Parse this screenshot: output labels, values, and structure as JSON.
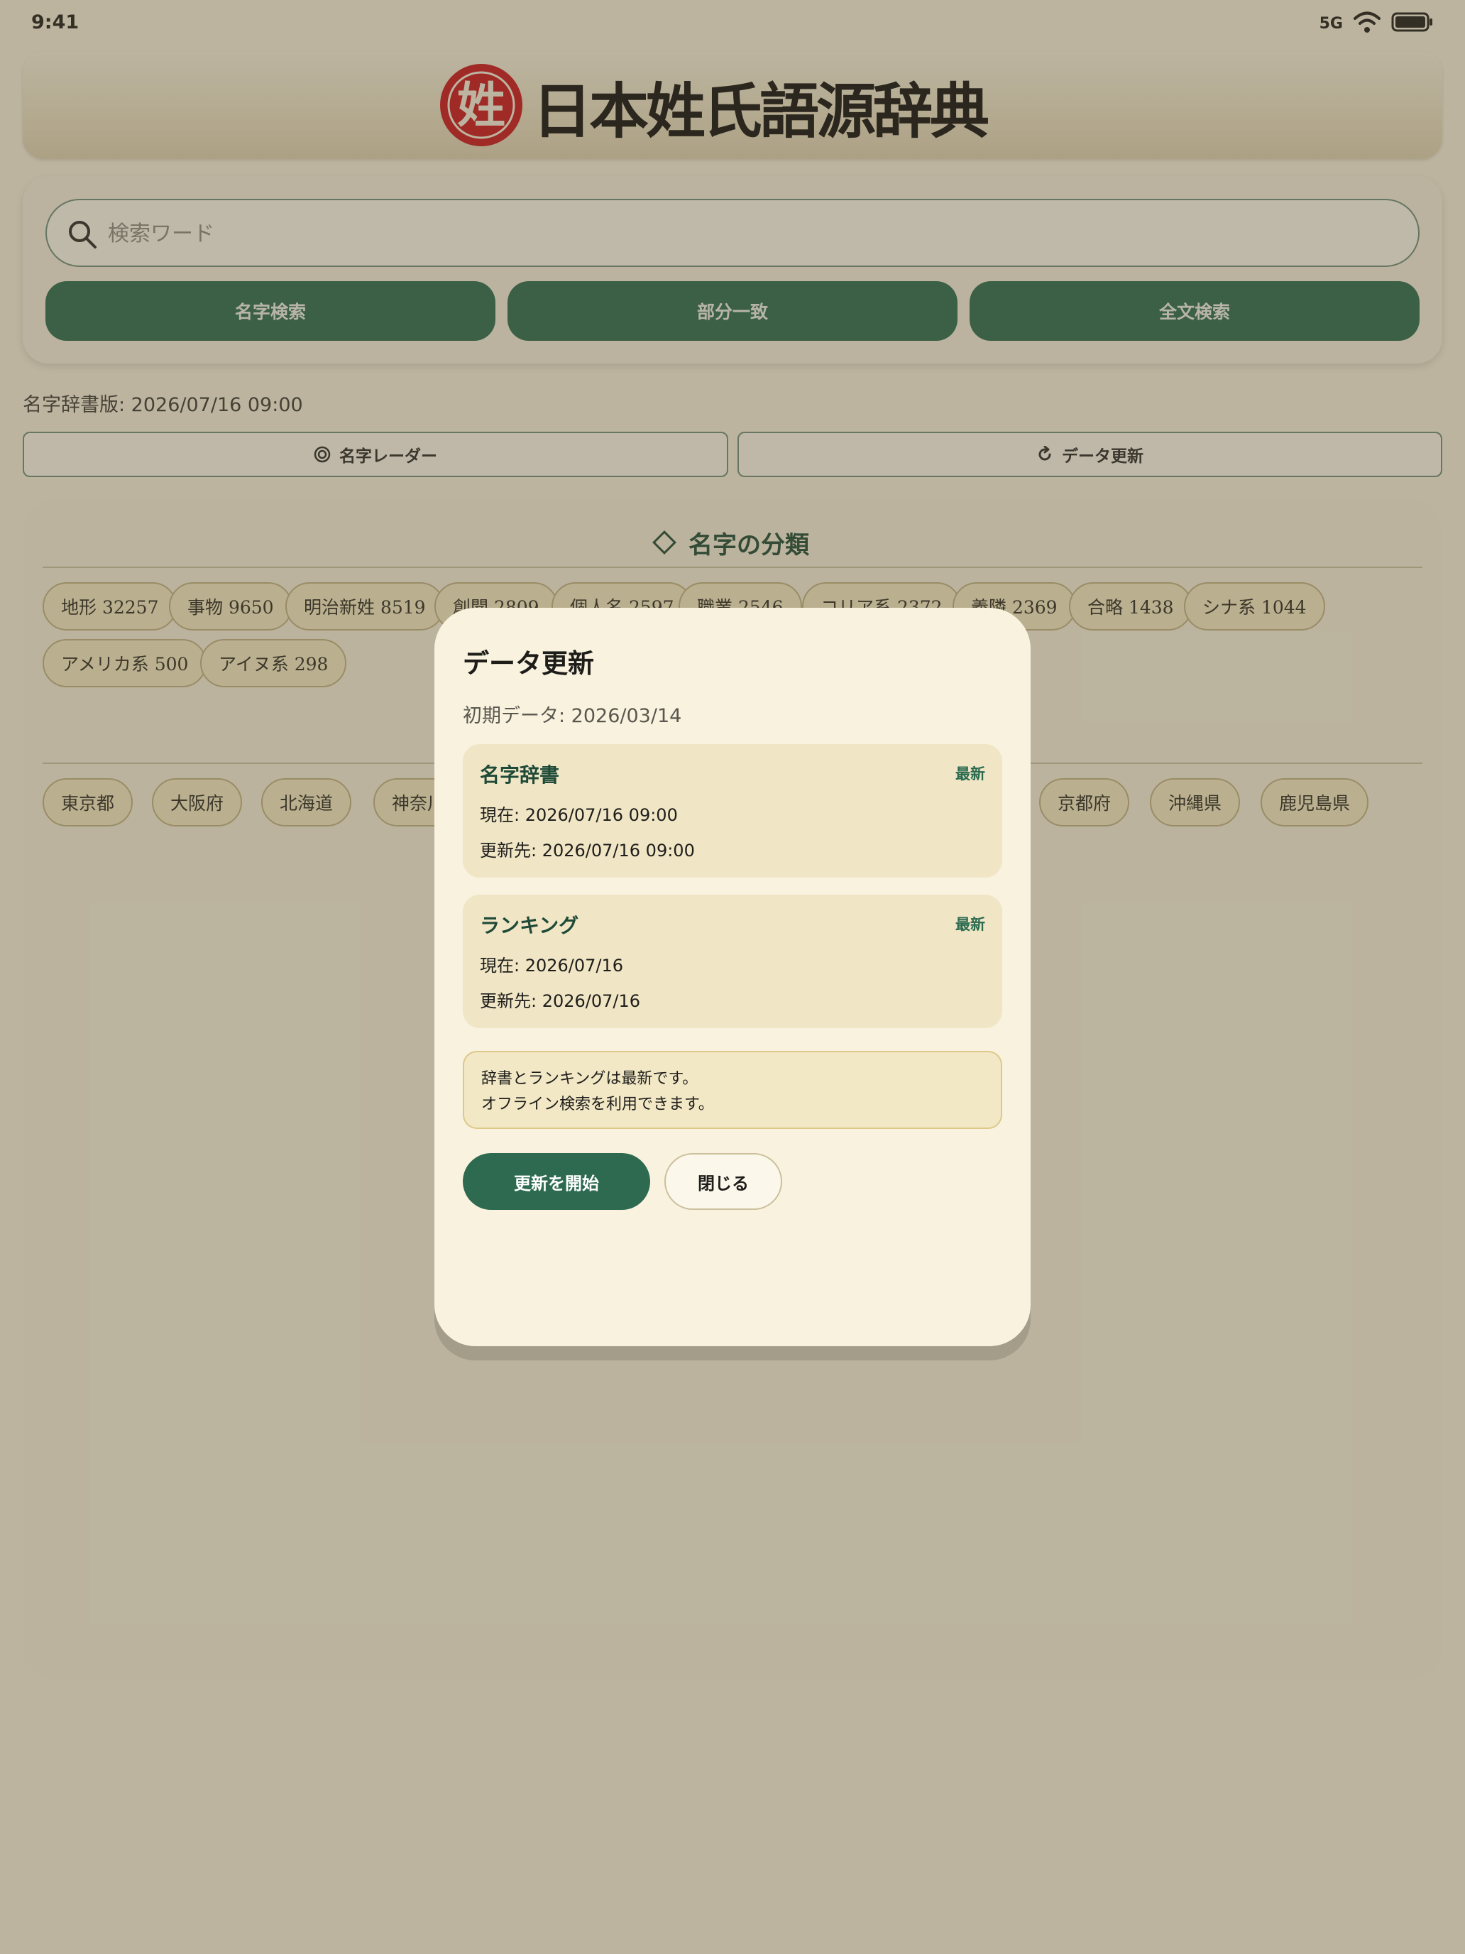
{
  "status_bar": {
    "time": "9:41",
    "network": "5G"
  },
  "header": {
    "logo_seal_char": "姓",
    "logo_text": "日本姓氏語源辞典"
  },
  "search": {
    "placeholder": "検索ワード",
    "buttons": [
      "名字検索",
      "部分一致",
      "全文検索"
    ]
  },
  "version_text": "名字辞書版: 2026/07/16 09:00",
  "tools": {
    "radar_label": "名字レーダー",
    "update_label": "データ更新"
  },
  "classification": {
    "title": "名字の分類",
    "categories": [
      "地形 32257",
      "事物 9650",
      "明治新姓 8519",
      "創聞 2809",
      "個人名 2597",
      "職業 2546",
      "コリア系 2372",
      "義隣 2369",
      "合略 1438",
      "シナ系 1044",
      "アメリカ系 500",
      "アイヌ系 298"
    ],
    "prefectures": [
      "東京都",
      "大阪府",
      "北海道",
      "神奈川県",
      "京都府",
      "沖縄県",
      "鹿児島県"
    ]
  },
  "modal": {
    "title": "データ更新",
    "initial_data": "初期データ: 2026/03/14",
    "cards": [
      {
        "title": "名字辞書",
        "badge": "最新",
        "current": "現在: 2026/07/16 09:00",
        "target": "更新先: 2026/07/16 09:00"
      },
      {
        "title": "ランキング",
        "badge": "最新",
        "current": "現在: 2026/07/16",
        "target": "更新先: 2026/07/16"
      }
    ],
    "notice_line1": "辞書とランキングは最新です。",
    "notice_line2": "オフライン検索を利用できます。",
    "start_button": "更新を開始",
    "close_button": "閉じる"
  },
  "colors": {
    "accent": "#2a6a4f",
    "modal_bg": "#f8f2de",
    "chip_bg": "#f3e9c4",
    "logo_red": "#cc1a1a"
  }
}
